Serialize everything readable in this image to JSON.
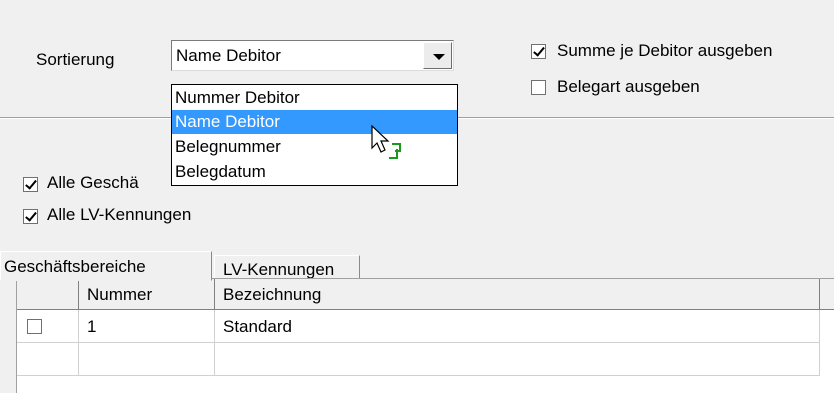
{
  "sort": {
    "label": "Sortierung",
    "selected_value": "Name Debitor",
    "options": [
      "Nummer Debitor",
      "Name Debitor",
      "Belegnummer",
      "Belegdatum"
    ],
    "highlighted_option": "Name Debitor"
  },
  "options_right": {
    "sum_per_debtor": {
      "label": "Summe je Debitor ausgeben",
      "checked": true
    },
    "document_type": {
      "label": "Belegart ausgeben",
      "checked": false
    }
  },
  "filters": {
    "all_business_areas": {
      "label": "Alle Geschä",
      "checked": true
    },
    "all_lv_ids": {
      "label": "Alle LV-Kennungen",
      "checked": true
    }
  },
  "tabs": [
    {
      "label": "Geschäftsbereiche",
      "active": true
    },
    {
      "label": "LV-Kennungen",
      "active": false
    }
  ],
  "grid": {
    "columns": [
      "",
      "Nummer",
      "Bezeichnung"
    ],
    "rows": [
      {
        "selected": false,
        "number": "1",
        "name": "Standard"
      }
    ]
  },
  "colors": {
    "selection": "#3399ff",
    "background": "#f0f0f0",
    "cursor_badge": "#1a9a1a"
  }
}
